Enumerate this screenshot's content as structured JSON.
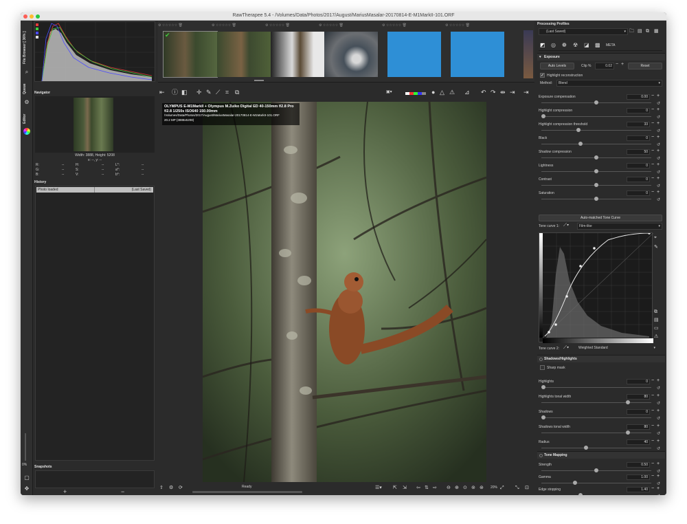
{
  "window": {
    "title": "RawTherapee 5.4 - /Volumes/Data/Photos/2017/August/MariusMasalar-20170814-E-M1MarkII-101.ORF",
    "colors": {
      "close": "#fc5f57",
      "minimize": "#fdbc2e",
      "zoom": "#28c840"
    }
  },
  "vertical_tabs": {
    "file_browser": "File Browser [ 36% ]",
    "queue": "Queue",
    "editor": "Editor",
    "zoom_value": "0%"
  },
  "navigator": {
    "title": "Navigator",
    "dimensions": "Width: 3888, Height: 5208",
    "coords": "x: --, y: --",
    "readouts": [
      {
        "label": "R:",
        "value": "--"
      },
      {
        "label": "H:",
        "value": "--"
      },
      {
        "label": "L*:",
        "value": "--"
      },
      {
        "label": "G:",
        "value": "--"
      },
      {
        "label": "S:",
        "value": "--"
      },
      {
        "label": "a*:",
        "value": "--"
      },
      {
        "label": "B:",
        "value": "--"
      },
      {
        "label": "V:",
        "value": "--"
      },
      {
        "label": "b*:",
        "value": "--"
      }
    ]
  },
  "history": {
    "title": "History",
    "rows": [
      {
        "action": "Photo loaded",
        "value": "(Last Saved)"
      }
    ]
  },
  "snapshots": {
    "title": "Snapshots",
    "add": "+",
    "remove": "−"
  },
  "image_info": {
    "line1": "OLYMPUS E-M1MarkII + Olympus M.Zuiko Digital ED 40-150mm f/2.8 Pro",
    "line2": "f/2.8  1/250s  ISO640  150.00mm",
    "line3": "/Volumes/Data/Photos/2017/August/MariusMasalar-20170814-E-M1MarkII-101.ORF",
    "line4": "20.2 MP (3888x5208)"
  },
  "status": {
    "text": "Ready",
    "zoom": "20%"
  },
  "processing_profiles": {
    "title": "Processing Profiles",
    "selected": "(Last Saved)"
  },
  "exposure": {
    "title": "Exposure",
    "auto_levels": "Auto Levels",
    "clip_label": "Clip %",
    "clip_value": "0.02",
    "reset": "Reset",
    "highlight_reconstruction": "Highlight reconstruction",
    "method_label": "Method:",
    "method_value": "Blend",
    "sliders": [
      {
        "label": "Exposure compensation",
        "value": "0.00",
        "pos": 0.5
      },
      {
        "label": "Highlight compression",
        "value": "0",
        "pos": 0.0
      },
      {
        "label": "Highlight compression threshold",
        "value": "33",
        "pos": 0.33
      },
      {
        "label": "Black",
        "value": "0",
        "pos": 0.35
      },
      {
        "label": "Shadow compression",
        "value": "50",
        "pos": 0.5
      },
      {
        "label": "Lightness",
        "value": "0",
        "pos": 0.5
      },
      {
        "label": "Contrast",
        "value": "0",
        "pos": 0.5
      },
      {
        "label": "Saturation",
        "value": "0",
        "pos": 0.5
      }
    ],
    "auto_tone_curve": "Auto-matched Tone Curve",
    "tone_curve_1_label": "Tone curve 1:",
    "tone_curve_1_value": "Film-like",
    "tone_curve_2_label": "Tone curve 2:",
    "tone_curve_2_value": "Weighted Standard"
  },
  "shadows_highlights": {
    "title": "Shadows/Highlights",
    "sharp_mask": "Sharp mask",
    "sliders": [
      {
        "label": "Highlights",
        "value": "0",
        "pos": 0.0
      },
      {
        "label": "Highlights tonal width",
        "value": "80",
        "pos": 0.8
      },
      {
        "label": "Shadows",
        "value": "0",
        "pos": 0.0
      },
      {
        "label": "Shadows tonal width",
        "value": "80",
        "pos": 0.8
      },
      {
        "label": "Radius",
        "value": "40",
        "pos": 0.4
      }
    ]
  },
  "tone_mapping": {
    "title": "Tone Mapping",
    "sliders": [
      {
        "label": "Strength",
        "value": "0.50",
        "pos": 0.5
      },
      {
        "label": "Gamma",
        "value": "1.00",
        "pos": 0.3
      },
      {
        "label": "Edge stopping",
        "value": "1.40",
        "pos": 0.35
      }
    ]
  }
}
